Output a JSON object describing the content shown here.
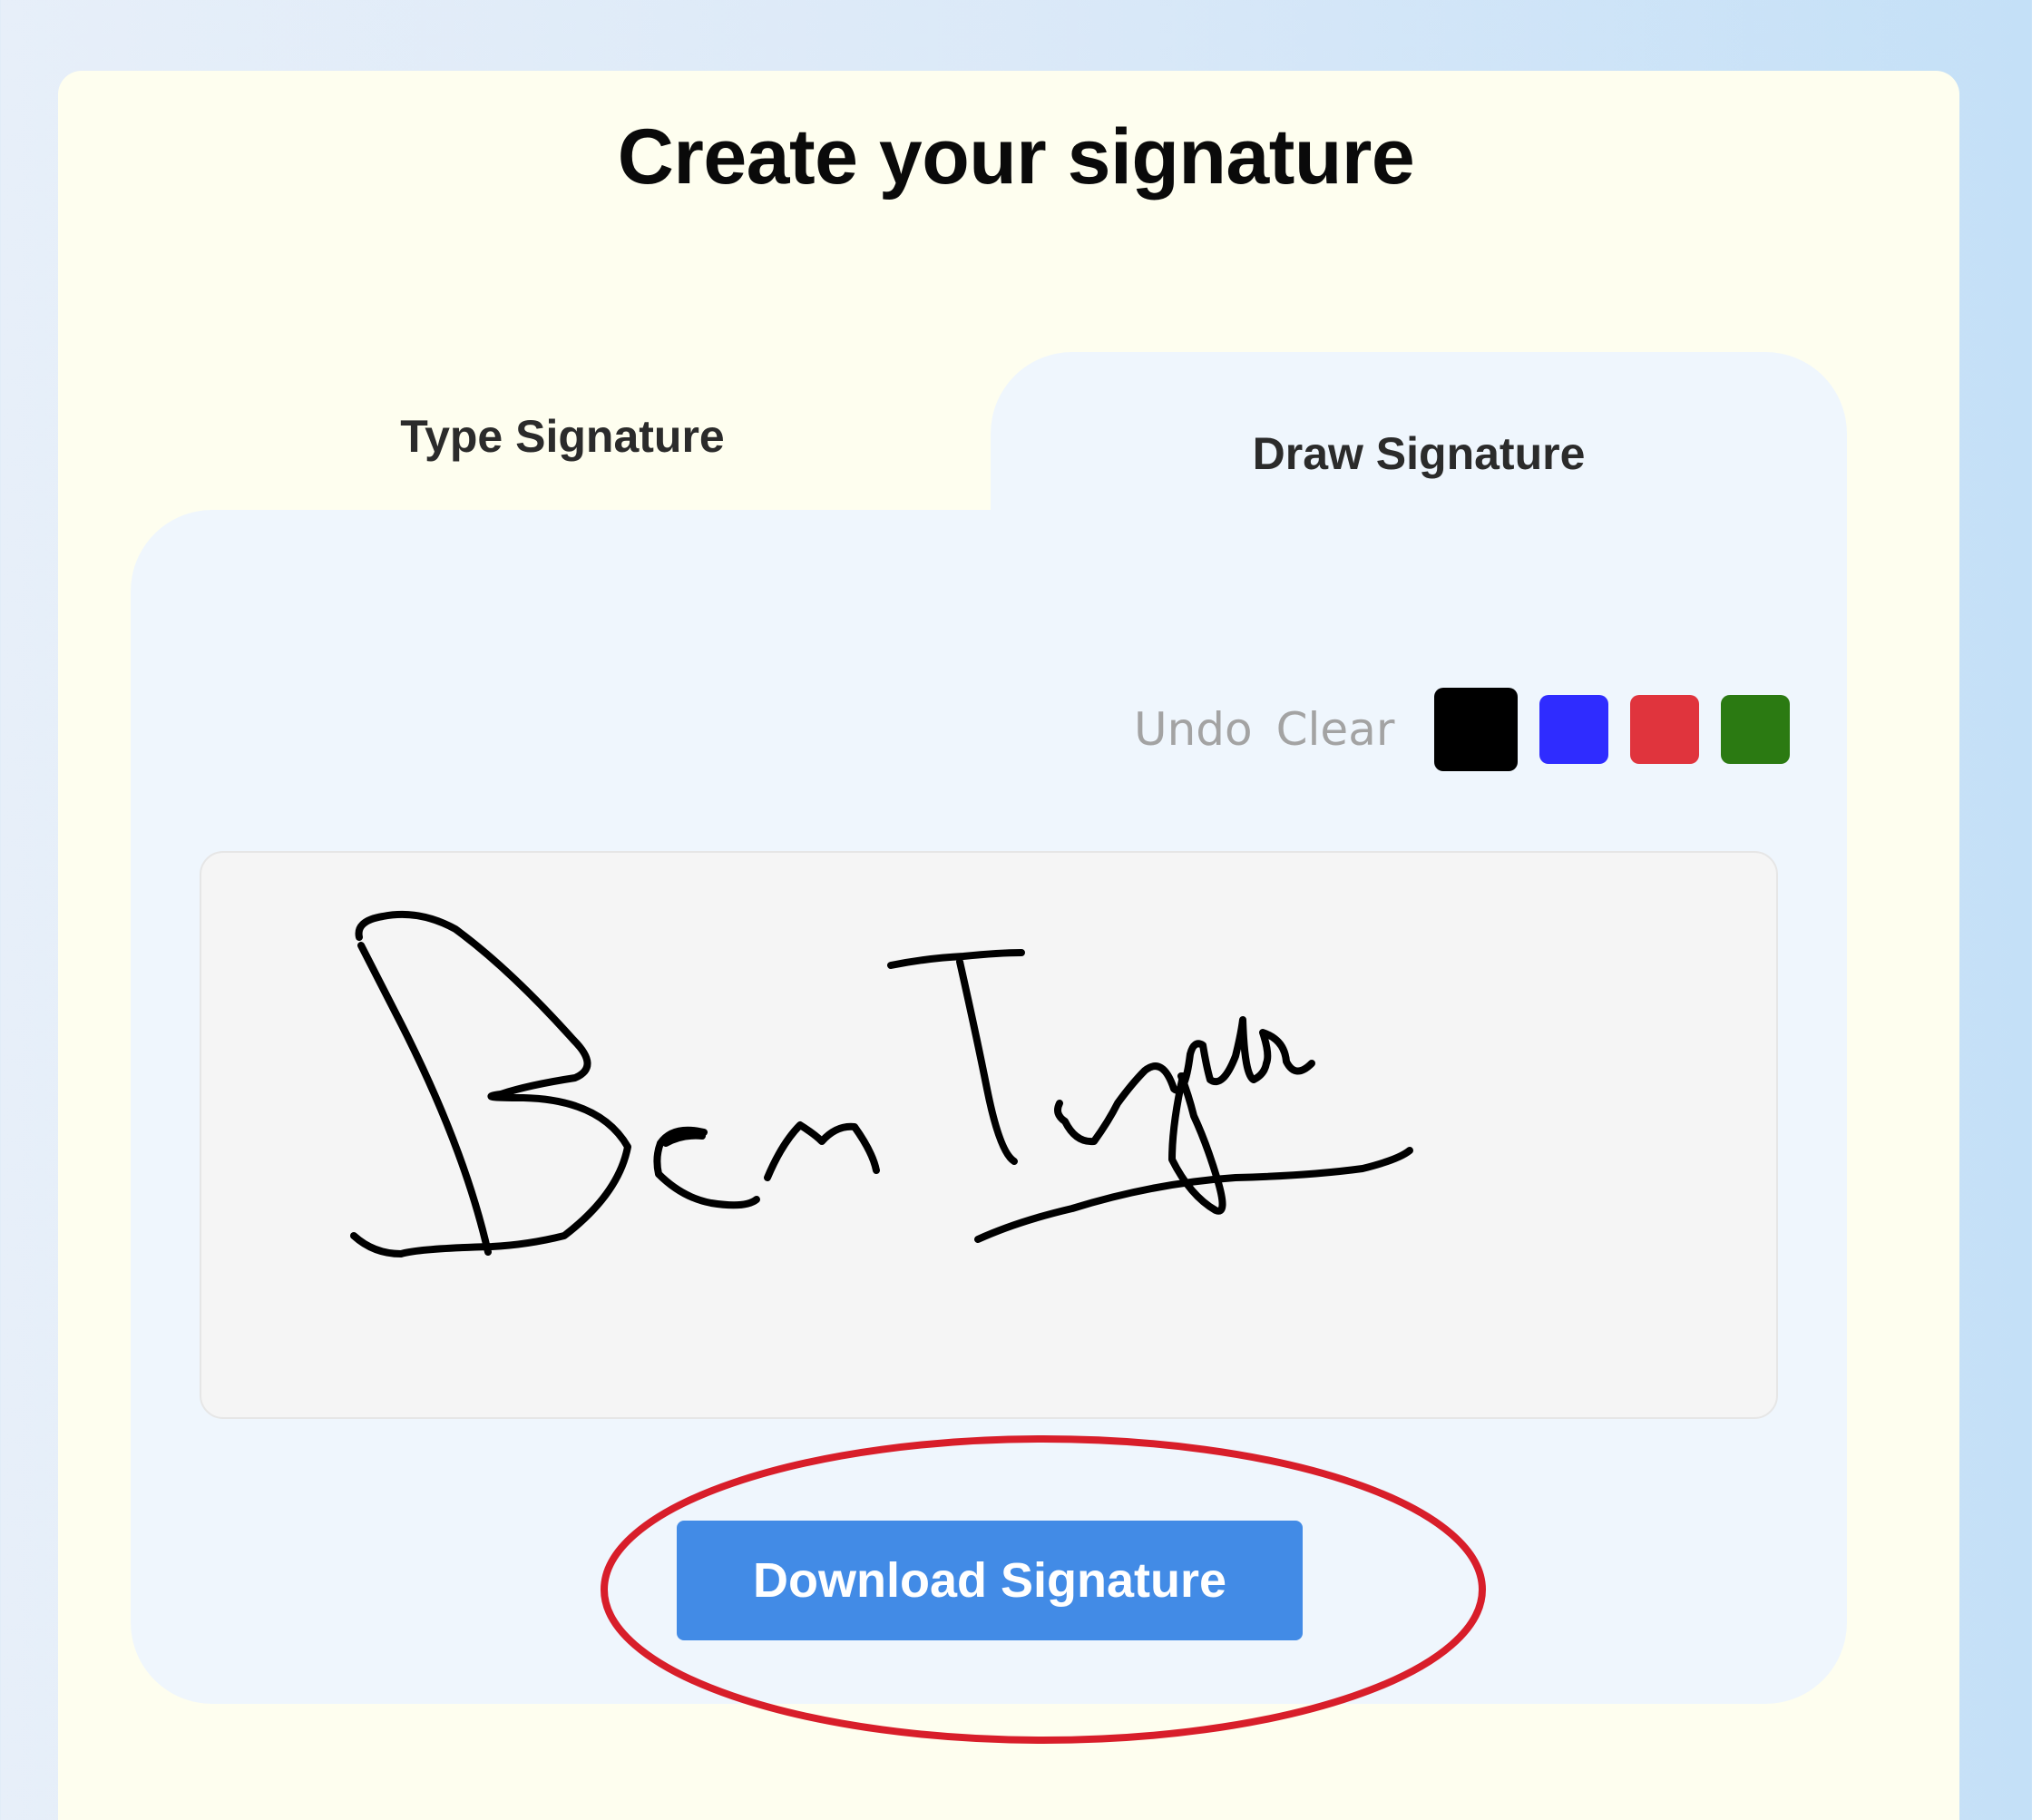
{
  "page": {
    "title": "Create your signature"
  },
  "tabs": [
    {
      "label": "Type Signature",
      "active": false
    },
    {
      "label": "Draw Signature",
      "active": true
    }
  ],
  "toolbar": {
    "undo_label": "Undo",
    "clear_label": "Clear"
  },
  "pen_colors": [
    {
      "name": "black",
      "hex": "#000000",
      "selected": true
    },
    {
      "name": "blue",
      "hex": "#2f2cff",
      "selected": false
    },
    {
      "name": "red",
      "hex": "#e0343d",
      "selected": false
    },
    {
      "name": "green",
      "hex": "#2b7a12",
      "selected": false
    }
  ],
  "signature": {
    "handwritten_text": "Ben Taylor",
    "ink_color": "#000000"
  },
  "actions": {
    "download_label": "Download Signature"
  },
  "annotation": {
    "highlight_color": "#d81e2a"
  }
}
